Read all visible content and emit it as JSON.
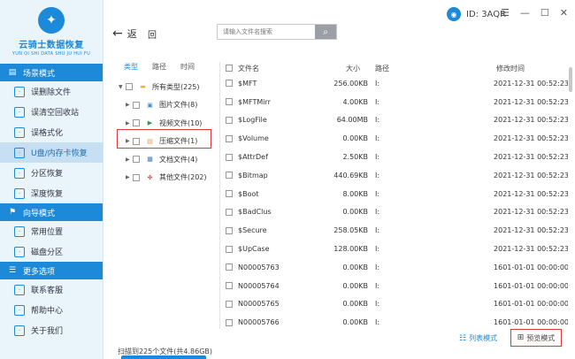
{
  "app": {
    "logo_text": "云骑士数据恢复",
    "logo_sub": "YUN QI SHI DATA SHU JU HUI FU",
    "user_id_label": "ID: 3AQR",
    "accent": "#1c8ad8"
  },
  "sidebar": {
    "sections": [
      {
        "title": "场景模式",
        "items": [
          {
            "label": "误删除文件",
            "icon": "trash-icon"
          },
          {
            "label": "误清空回收站",
            "icon": "recycle-bin-icon"
          },
          {
            "label": "误格式化",
            "icon": "format-icon"
          },
          {
            "label": "U盘/内存卡恢复",
            "icon": "usb-icon",
            "active": true
          },
          {
            "label": "分区恢复",
            "icon": "partition-icon"
          },
          {
            "label": "深度恢复",
            "icon": "deep-scan-icon"
          }
        ]
      },
      {
        "title": "向导模式",
        "items": [
          {
            "label": "常用位置",
            "icon": "location-icon"
          },
          {
            "label": "磁盘分区",
            "icon": "disk-icon"
          }
        ]
      },
      {
        "title": "更多选项",
        "items": [
          {
            "label": "联系客服",
            "icon": "support-icon"
          },
          {
            "label": "帮助中心",
            "icon": "help-icon"
          },
          {
            "label": "关于我们",
            "icon": "info-icon"
          }
        ]
      }
    ]
  },
  "toolbar": {
    "back_label": "返",
    "home_label": "回",
    "search_placeholder": "请输入文件名搜索"
  },
  "tree": {
    "tabs": [
      "类型",
      "路径",
      "时间"
    ],
    "rows": [
      {
        "label": "所有类型(225)",
        "level": 0,
        "icon": "folder-icon",
        "icon_char": "▬",
        "color": "#f2b53b"
      },
      {
        "label": "图片文件(8)",
        "level": 1,
        "icon": "image-file-icon",
        "icon_char": "▣",
        "color": "#4a90c8"
      },
      {
        "label": "视频文件(10)",
        "level": 1,
        "icon": "video-file-icon",
        "icon_char": "▶",
        "color": "#2e9a55"
      },
      {
        "label": "压缩文件(1)",
        "level": 1,
        "icon": "zip-file-icon",
        "icon_char": "▤",
        "color": "#e69c24"
      },
      {
        "label": "文档文件(4)",
        "level": 1,
        "icon": "document-file-icon",
        "icon_char": "▦",
        "color": "#3a78c6"
      },
      {
        "label": "其他文件(202)",
        "level": 1,
        "icon": "other-file-icon",
        "icon_char": "✤",
        "color": "#d9534f"
      }
    ]
  },
  "table": {
    "headers": [
      "文件名",
      "大小",
      "路径",
      "修改时间"
    ],
    "rows": [
      [
        "$MFT",
        "256.00KB",
        "I:",
        "2021-12-31 00:52:23"
      ],
      [
        "$MFTMirr",
        "4.00KB",
        "I:",
        "2021-12-31 00:52:23"
      ],
      [
        "$LogFile",
        "64.00MB",
        "I:",
        "2021-12-31 00:52:23"
      ],
      [
        "$Volume",
        "0.00KB",
        "I:",
        "2021-12-31 00:52:23"
      ],
      [
        "$AttrDef",
        "2.50KB",
        "I:",
        "2021-12-31 00:52:23"
      ],
      [
        "$Bitmap",
        "440.69KB",
        "I:",
        "2021-12-31 00:52:23"
      ],
      [
        "$Boot",
        "8.00KB",
        "I:",
        "2021-12-31 00:52:23"
      ],
      [
        "$BadClus",
        "0.00KB",
        "I:",
        "2021-12-31 00:52:23"
      ],
      [
        "$Secure",
        "258.05KB",
        "I:",
        "2021-12-31 00:52:23"
      ],
      [
        "$UpCase",
        "128.00KB",
        "I:",
        "2021-12-31 00:52:23"
      ],
      [
        "N00005763",
        "0.00KB",
        "I:",
        "1601-01-01 00:00:00"
      ],
      [
        "N00005764",
        "0.00KB",
        "I:",
        "1601-01-01 00:00:00"
      ],
      [
        "N00005765",
        "0.00KB",
        "I:",
        "1601-01-01 00:00:00"
      ],
      [
        "N00005766",
        "0.00KB",
        "I:",
        "1601-01-01 00:00:00"
      ]
    ]
  },
  "footer": {
    "scan_status": "扫描到225个文件(共4.86GB)",
    "list_view_label": "列表模式",
    "preview_view_label": "预览模式"
  }
}
